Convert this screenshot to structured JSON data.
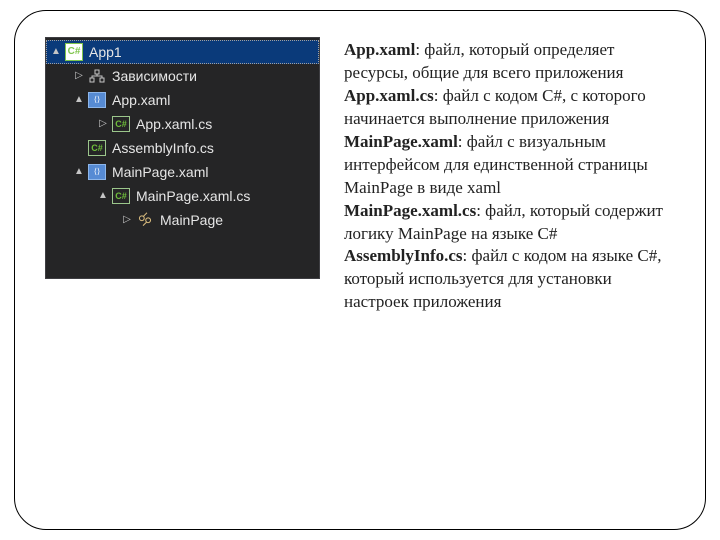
{
  "tree": {
    "project": "App1",
    "deps": "Зависимости",
    "app_xaml": "App.xaml",
    "app_xaml_cs": "App.xaml.cs",
    "assembly": "AssemblyInfo.cs",
    "mainpage_xaml": "MainPage.xaml",
    "mainpage_xaml_cs": "MainPage.xaml.cs",
    "mainpage_class": "MainPage",
    "cs_badge": "C#"
  },
  "desc": {
    "t1": "App.xaml",
    "d1": ": файл, который определяет ресурсы, общие для всего приложения",
    "t2": "App.xaml.cs",
    "d2": ": файл с кодом C#, с которого начинается выполнение приложения",
    "t3": "MainPage.xaml",
    "d3": ": файл с визуальным интерфейсом для единственной страницы MainPage в виде xaml",
    "t4": "MainPage.xaml.cs",
    "d4": ": файл, который содержит логику MainPage на языке C#",
    "t5": "AssemblyInfo.cs",
    "d5": ": файл с кодом на языке C#, который используется для установки настроек приложения"
  }
}
